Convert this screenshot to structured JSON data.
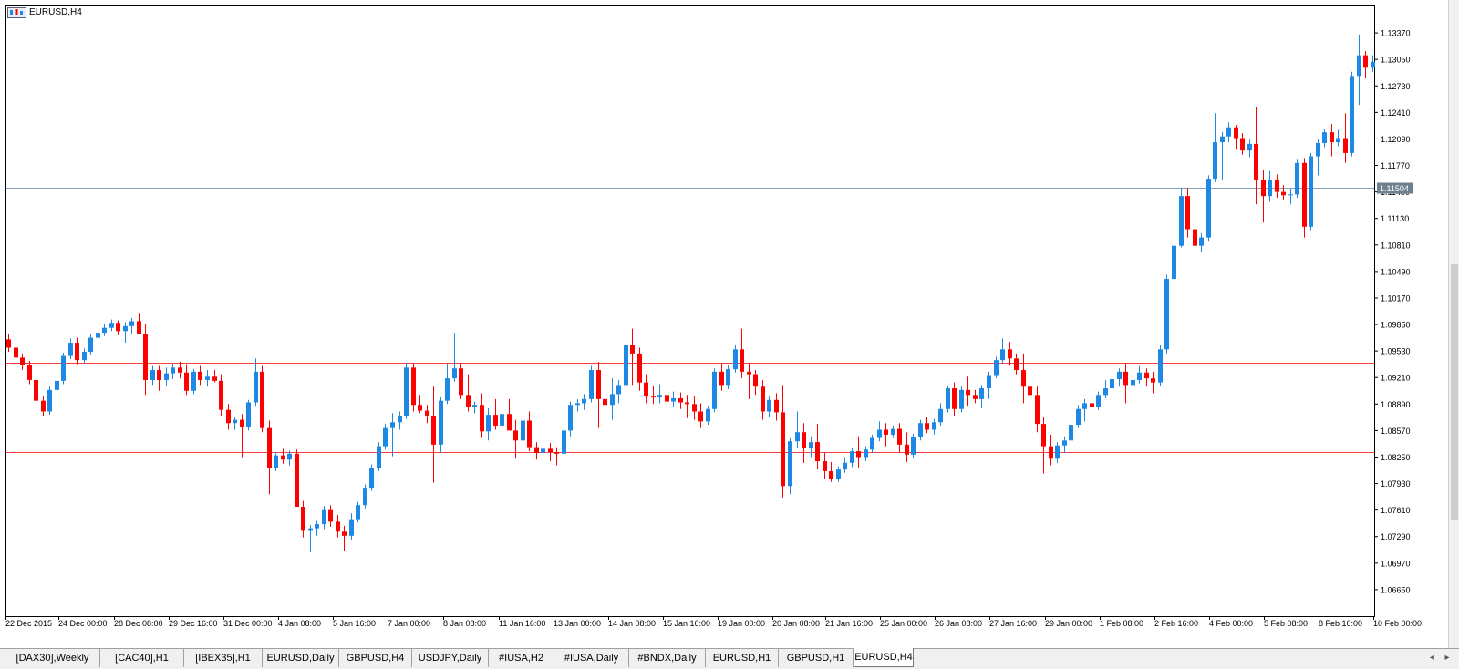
{
  "window": {
    "chart_title": "EURUSD,H4"
  },
  "colors": {
    "bull": "#1e88e5",
    "bear": "#ff0000",
    "bid_line": "#8aa0b8",
    "level_line": "#ff3b3b",
    "price_label_bg": "#6e7f90",
    "axis_text": "#000000",
    "grid_border": "#000000"
  },
  "current_price": {
    "label": "1.11504",
    "value": 1.11504
  },
  "levels": [
    1.0939,
    1.0831
  ],
  "price_axis": {
    "labels": [
      "1.13370",
      "1.13050",
      "1.12730",
      "1.12410",
      "1.12090",
      "1.11770",
      "1.11450",
      "1.11130",
      "1.10810",
      "1.10490",
      "1.10170",
      "1.09850",
      "1.09530",
      "1.09210",
      "1.08890",
      "1.08570",
      "1.08250",
      "1.07930",
      "1.07610",
      "1.07290",
      "1.06970",
      "1.06650"
    ]
  },
  "time_axis": {
    "labels": [
      "22 Dec 2015",
      "24 Dec 00:00",
      "28 Dec 08:00",
      "29 Dec 16:00",
      "31 Dec 00:00",
      "4 Jan 08:00",
      "5 Jan 16:00",
      "7 Jan 00:00",
      "8 Jan 08:00",
      "11 Jan 16:00",
      "13 Jan 00:00",
      "14 Jan 08:00",
      "15 Jan 16:00",
      "19 Jan 00:00",
      "20 Jan 08:00",
      "21 Jan 16:00",
      "25 Jan 00:00",
      "26 Jan 08:00",
      "27 Jan 16:00",
      "29 Jan 00:00",
      "1 Feb 08:00",
      "2 Feb 16:00",
      "4 Feb 00:00",
      "5 Feb 08:00",
      "8 Feb 16:00",
      "10 Feb 00:00"
    ]
  },
  "tabs": [
    {
      "label": "[DAX30],Weekly",
      "active": false
    },
    {
      "label": "[CAC40],H1",
      "active": false
    },
    {
      "label": "[IBEX35],H1",
      "active": false
    },
    {
      "label": "EURUSD,Daily",
      "active": false
    },
    {
      "label": "GBPUSD,H4",
      "active": false
    },
    {
      "label": "USDJPY,Daily",
      "active": false
    },
    {
      "label": "#IUSA,H2",
      "active": false
    },
    {
      "label": "#IUSA,Daily",
      "active": false
    },
    {
      "label": "#BNDX,Daily",
      "active": false
    },
    {
      "label": "EURUSD,H1",
      "active": false
    },
    {
      "label": "GBPUSD,H1",
      "active": false
    },
    {
      "label": "EURUSD,H4",
      "active": true
    }
  ],
  "scroll": {
    "left": "◂",
    "right": "▸"
  },
  "chart_data": {
    "type": "candlestick",
    "symbol": "EURUSD,H4",
    "ylim": [
      1.0633,
      1.1369
    ],
    "candles": [
      [
        1.0967,
        1.0973,
        1.0952,
        1.0957
      ],
      [
        1.0957,
        1.0961,
        1.094,
        1.0945
      ],
      [
        1.0945,
        1.095,
        1.093,
        1.0936
      ],
      [
        1.0936,
        1.0941,
        1.0913,
        1.0918
      ],
      [
        1.0918,
        1.0923,
        1.0888,
        1.0893
      ],
      [
        1.0893,
        1.0898,
        1.0875,
        1.088
      ],
      [
        1.088,
        1.091,
        1.0876,
        1.0906
      ],
      [
        1.0906,
        1.0921,
        1.0902,
        1.0917
      ],
      [
        1.0917,
        1.0951,
        1.0913,
        1.0947
      ],
      [
        1.0947,
        1.0968,
        1.0943,
        1.0963
      ],
      [
        1.0963,
        1.0969,
        1.0937,
        1.0942
      ],
      [
        1.0942,
        1.0956,
        1.0938,
        1.0952
      ],
      [
        1.0952,
        1.0973,
        1.0948,
        1.0969
      ],
      [
        1.0969,
        1.0979,
        1.0965,
        1.0975
      ],
      [
        1.0975,
        1.0985,
        1.0971,
        1.0981
      ],
      [
        1.0981,
        1.0991,
        1.0977,
        1.0987
      ],
      [
        1.0987,
        1.099,
        1.0972,
        1.0977
      ],
      [
        1.0977,
        1.0988,
        1.0963,
        1.0983
      ],
      [
        1.0983,
        1.0993,
        1.0973,
        1.0989
      ],
      [
        1.0989,
        1.0999,
        1.0979,
        1.0973
      ],
      [
        1.0973,
        1.0985,
        1.09,
        1.0918
      ],
      [
        1.0918,
        1.0935,
        1.0912,
        1.093
      ],
      [
        1.093,
        1.0935,
        1.0905,
        1.0918
      ],
      [
        1.0918,
        1.0933,
        1.0911,
        1.0926
      ],
      [
        1.0926,
        1.0938,
        1.0919,
        1.0933
      ],
      [
        1.0933,
        1.094,
        1.092,
        1.0927
      ],
      [
        1.0927,
        1.0937,
        1.09,
        1.0905
      ],
      [
        1.0905,
        1.0931,
        1.0901,
        1.0928
      ],
      [
        1.0928,
        1.0935,
        1.0912,
        1.0918
      ],
      [
        1.0918,
        1.093,
        1.091,
        1.0922
      ],
      [
        1.0922,
        1.093,
        1.0915,
        1.0917
      ],
      [
        1.0917,
        1.0925,
        1.0875,
        1.0882
      ],
      [
        1.0882,
        1.0889,
        1.0858,
        1.0866
      ],
      [
        1.0866,
        1.0874,
        1.0858,
        1.087
      ],
      [
        1.087,
        1.0877,
        1.0825,
        1.0861
      ],
      [
        1.0861,
        1.0894,
        1.0857,
        1.0891
      ],
      [
        1.0891,
        1.0944,
        1.0887,
        1.0928
      ],
      [
        1.0928,
        1.0935,
        1.0855,
        1.086
      ],
      [
        1.086,
        1.0869,
        1.078,
        1.0812
      ],
      [
        1.0812,
        1.0831,
        1.0808,
        1.0827
      ],
      [
        1.0827,
        1.0835,
        1.0817,
        1.0822
      ],
      [
        1.0822,
        1.0833,
        1.0815,
        1.0829
      ],
      [
        1.0829,
        1.0834,
        1.0797,
        1.0765
      ],
      [
        1.0765,
        1.0772,
        1.0728,
        1.0736
      ],
      [
        1.0736,
        1.0743,
        1.071,
        1.0739
      ],
      [
        1.0739,
        1.0748,
        1.073,
        1.0744
      ],
      [
        1.0744,
        1.0766,
        1.0738,
        1.0761
      ],
      [
        1.0761,
        1.0767,
        1.0741,
        1.0747
      ],
      [
        1.0747,
        1.0755,
        1.0728,
        1.0735
      ],
      [
        1.0735,
        1.0742,
        1.0712,
        1.073
      ],
      [
        1.073,
        1.0757,
        1.0725,
        1.075
      ],
      [
        1.075,
        1.0771,
        1.0746,
        1.0767
      ],
      [
        1.0767,
        1.0792,
        1.0763,
        1.0788
      ],
      [
        1.0788,
        1.0816,
        1.0784,
        1.0812
      ],
      [
        1.0812,
        1.0843,
        1.0808,
        1.0838
      ],
      [
        1.0838,
        1.0865,
        1.0834,
        1.086
      ],
      [
        1.086,
        1.0878,
        1.0826,
        1.0867
      ],
      [
        1.0867,
        1.088,
        1.0858,
        1.0875
      ],
      [
        1.0875,
        1.0939,
        1.0871,
        1.0933
      ],
      [
        1.0933,
        1.0938,
        1.088,
        1.0888
      ],
      [
        1.0888,
        1.09,
        1.0878,
        1.0881
      ],
      [
        1.0881,
        1.0888,
        1.0866,
        1.0875
      ],
      [
        1.0875,
        1.091,
        1.0794,
        1.084
      ],
      [
        1.084,
        1.0897,
        1.083,
        1.0893
      ],
      [
        1.0893,
        1.0938,
        1.0889,
        1.092
      ],
      [
        1.092,
        1.0975,
        1.0916,
        1.0932
      ],
      [
        1.0932,
        1.0938,
        1.0895,
        1.09
      ],
      [
        1.09,
        1.0925,
        1.088,
        1.0885
      ],
      [
        1.0885,
        1.0892,
        1.0878,
        1.0888
      ],
      [
        1.0888,
        1.0902,
        1.0848,
        1.0856
      ],
      [
        1.0856,
        1.0884,
        1.0845,
        1.0876
      ],
      [
        1.0876,
        1.0895,
        1.0858,
        1.0863
      ],
      [
        1.0863,
        1.0883,
        1.0842,
        1.0877
      ],
      [
        1.0877,
        1.0895,
        1.086,
        1.0857
      ],
      [
        1.0857,
        1.087,
        1.0823,
        1.0845
      ],
      [
        1.0845,
        1.0874,
        1.083,
        1.0869
      ],
      [
        1.0869,
        1.088,
        1.0832,
        1.0837
      ],
      [
        1.0837,
        1.0843,
        1.0822,
        1.083
      ],
      [
        1.083,
        1.084,
        1.0815,
        1.0835
      ],
      [
        1.0835,
        1.0842,
        1.082,
        1.0831
      ],
      [
        1.0831,
        1.0837,
        1.0815,
        1.0829
      ],
      [
        1.0829,
        1.086,
        1.0825,
        1.0857
      ],
      [
        1.0857,
        1.0892,
        1.085,
        1.0888
      ],
      [
        1.0888,
        1.0895,
        1.088,
        1.089
      ],
      [
        1.089,
        1.0901,
        1.0882,
        1.0895
      ],
      [
        1.0895,
        1.0935,
        1.0891,
        1.093
      ],
      [
        1.093,
        1.094,
        1.086,
        1.0895
      ],
      [
        1.0895,
        1.0901,
        1.0875,
        1.0888
      ],
      [
        1.0888,
        1.092,
        1.087,
        1.0901
      ],
      [
        1.0901,
        1.0918,
        1.089,
        1.0912
      ],
      [
        1.0912,
        1.099,
        1.0908,
        1.096
      ],
      [
        1.096,
        1.098,
        1.0912,
        1.095
      ],
      [
        1.095,
        1.0957,
        1.0905,
        1.0915
      ],
      [
        1.0915,
        1.0925,
        1.089,
        1.0898
      ],
      [
        1.0898,
        1.0911,
        1.0889,
        1.0897
      ],
      [
        1.0897,
        1.0913,
        1.089,
        1.09
      ],
      [
        1.09,
        1.0907,
        1.088,
        1.0892
      ],
      [
        1.0892,
        1.0904,
        1.0885,
        1.0896
      ],
      [
        1.0896,
        1.0903,
        1.0883,
        1.0891
      ],
      [
        1.0891,
        1.09,
        1.0872,
        1.0889
      ],
      [
        1.0889,
        1.0898,
        1.087,
        1.088
      ],
      [
        1.088,
        1.089,
        1.086,
        1.0868
      ],
      [
        1.0868,
        1.0887,
        1.0864,
        1.0883
      ],
      [
        1.0883,
        1.0932,
        1.0879,
        1.0928
      ],
      [
        1.0928,
        1.0938,
        1.0905,
        1.0912
      ],
      [
        1.0912,
        1.0936,
        1.0907,
        1.0931
      ],
      [
        1.0931,
        1.096,
        1.0927,
        1.0955
      ],
      [
        1.0955,
        1.098,
        1.092,
        1.0928
      ],
      [
        1.0928,
        1.0938,
        1.0895,
        1.0925
      ],
      [
        1.0925,
        1.093,
        1.09,
        1.091
      ],
      [
        1.091,
        1.0918,
        1.087,
        1.088
      ],
      [
        1.088,
        1.0898,
        1.0874,
        1.0894
      ],
      [
        1.0894,
        1.0902,
        1.0869,
        1.0879
      ],
      [
        1.0879,
        1.0912,
        1.0776,
        1.079
      ],
      [
        1.079,
        1.0848,
        1.078,
        1.0844
      ],
      [
        1.0844,
        1.088,
        1.0836,
        1.0855
      ],
      [
        1.0855,
        1.0866,
        1.0818,
        1.0836
      ],
      [
        1.0836,
        1.085,
        1.0825,
        1.0843
      ],
      [
        1.0843,
        1.0865,
        1.081,
        1.082
      ],
      [
        1.082,
        1.083,
        1.0798,
        1.0808
      ],
      [
        1.0808,
        1.0819,
        1.0795,
        1.0799
      ],
      [
        1.0799,
        1.0814,
        1.0795,
        1.081
      ],
      [
        1.081,
        1.0825,
        1.0806,
        1.0818
      ],
      [
        1.0818,
        1.0836,
        1.0813,
        1.0832
      ],
      [
        1.0832,
        1.085,
        1.0812,
        1.0825
      ],
      [
        1.0825,
        1.0838,
        1.082,
        1.0834
      ],
      [
        1.0834,
        1.0852,
        1.083,
        1.0848
      ],
      [
        1.0848,
        1.0868,
        1.0844,
        1.0858
      ],
      [
        1.0858,
        1.0866,
        1.0838,
        1.0852
      ],
      [
        1.0852,
        1.0863,
        1.0848,
        1.0859
      ],
      [
        1.0859,
        1.0866,
        1.0831,
        1.084
      ],
      [
        1.084,
        1.0855,
        1.0819,
        1.0828
      ],
      [
        1.0828,
        1.0853,
        1.0824,
        1.0849
      ],
      [
        1.0849,
        1.087,
        1.0845,
        1.0866
      ],
      [
        1.0866,
        1.0873,
        1.0854,
        1.0858
      ],
      [
        1.0858,
        1.0871,
        1.0852,
        1.0867
      ],
      [
        1.0867,
        1.089,
        1.0863,
        1.0883
      ],
      [
        1.0883,
        1.0911,
        1.0879,
        1.0908
      ],
      [
        1.0908,
        1.0915,
        1.0875,
        1.0883
      ],
      [
        1.0883,
        1.091,
        1.0879,
        1.0906
      ],
      [
        1.0906,
        1.0922,
        1.0887,
        1.09
      ],
      [
        1.09,
        1.0906,
        1.089,
        1.0895
      ],
      [
        1.0895,
        1.0912,
        1.0884,
        1.0908
      ],
      [
        1.0908,
        1.0928,
        1.0895,
        1.0924
      ],
      [
        1.0924,
        1.0946,
        1.092,
        1.0942
      ],
      [
        1.0942,
        1.0968,
        1.0938,
        1.0955
      ],
      [
        1.0955,
        1.0964,
        1.0935,
        1.0944
      ],
      [
        1.0944,
        1.095,
        1.0925,
        1.093
      ],
      [
        1.093,
        1.095,
        1.089,
        1.091
      ],
      [
        1.091,
        1.092,
        1.088,
        1.09
      ],
      [
        1.09,
        1.091,
        1.0855,
        1.0865
      ],
      [
        1.0865,
        1.0873,
        1.0805,
        1.0838
      ],
      [
        1.0838,
        1.0852,
        1.0815,
        1.0823
      ],
      [
        1.0823,
        1.0843,
        1.0818,
        1.0839
      ],
      [
        1.0839,
        1.085,
        1.083,
        1.0845
      ],
      [
        1.0845,
        1.0868,
        1.0841,
        1.0864
      ],
      [
        1.0864,
        1.0888,
        1.086,
        1.0883
      ],
      [
        1.0883,
        1.0895,
        1.0868,
        1.089
      ],
      [
        1.089,
        1.09,
        1.0876,
        1.0886
      ],
      [
        1.0886,
        1.0904,
        1.0882,
        1.09
      ],
      [
        1.09,
        1.0918,
        1.0896,
        1.0908
      ],
      [
        1.0908,
        1.0925,
        1.0904,
        1.0919
      ],
      [
        1.0919,
        1.0932,
        1.091,
        1.0928
      ],
      [
        1.0928,
        1.0938,
        1.089,
        1.0912
      ],
      [
        1.0912,
        1.0922,
        1.0898,
        1.0918
      ],
      [
        1.0918,
        1.0935,
        1.0914,
        1.0927
      ],
      [
        1.0927,
        1.0932,
        1.091,
        1.092
      ],
      [
        1.092,
        1.0928,
        1.0902,
        1.0915
      ],
      [
        1.0915,
        1.096,
        1.0911,
        1.0955
      ],
      [
        1.0955,
        1.1045,
        1.095,
        1.104
      ],
      [
        1.104,
        1.109,
        1.1035,
        1.108
      ],
      [
        1.108,
        1.115,
        1.1078,
        1.114
      ],
      [
        1.114,
        1.115,
        1.109,
        1.11
      ],
      [
        1.11,
        1.111,
        1.1075,
        1.108
      ],
      [
        1.108,
        1.1095,
        1.1073,
        1.109
      ],
      [
        1.109,
        1.1165,
        1.1086,
        1.1161
      ],
      [
        1.1161,
        1.124,
        1.1157,
        1.1205
      ],
      [
        1.1205,
        1.1217,
        1.116,
        1.1212
      ],
      [
        1.1212,
        1.1229,
        1.1205,
        1.1223
      ],
      [
        1.1223,
        1.1226,
        1.1196,
        1.121
      ],
      [
        1.121,
        1.1216,
        1.119,
        1.1195
      ],
      [
        1.1195,
        1.1208,
        1.1187,
        1.1203
      ],
      [
        1.1203,
        1.1248,
        1.113,
        1.116
      ],
      [
        1.116,
        1.1172,
        1.1108,
        1.114
      ],
      [
        1.114,
        1.117,
        1.1133,
        1.116
      ],
      [
        1.116,
        1.1166,
        1.1138,
        1.1145
      ],
      [
        1.1145,
        1.1153,
        1.1136,
        1.1141
      ],
      [
        1.1141,
        1.1149,
        1.113,
        1.1142
      ],
      [
        1.1142,
        1.1185,
        1.1138,
        1.118
      ],
      [
        1.118,
        1.1186,
        1.109,
        1.1103
      ],
      [
        1.1103,
        1.1192,
        1.1099,
        1.1188
      ],
      [
        1.1188,
        1.1209,
        1.1165,
        1.1204
      ],
      [
        1.1204,
        1.1221,
        1.1199,
        1.1217
      ],
      [
        1.1217,
        1.1227,
        1.1188,
        1.1205
      ],
      [
        1.1205,
        1.122,
        1.12,
        1.121
      ],
      [
        1.121,
        1.124,
        1.118,
        1.1192
      ],
      [
        1.1192,
        1.129,
        1.1188,
        1.1285
      ],
      [
        1.1285,
        1.1335,
        1.125,
        1.131
      ],
      [
        1.131,
        1.1315,
        1.1282,
        1.1295
      ],
      [
        1.1295,
        1.131,
        1.129,
        1.1302
      ]
    ]
  }
}
